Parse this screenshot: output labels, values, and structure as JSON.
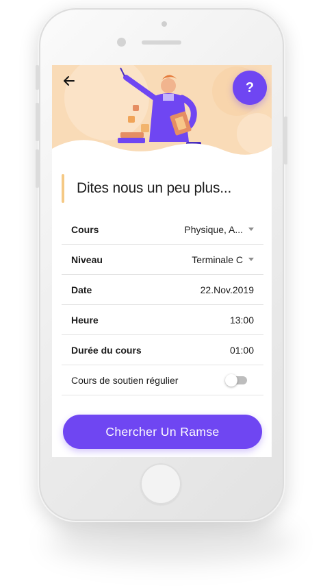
{
  "header": {
    "back_icon": "arrow-left-icon",
    "help_label": "?"
  },
  "section": {
    "title": "Dites nous un peu plus..."
  },
  "form": {
    "cours": {
      "label": "Cours",
      "value": "Physique, A..."
    },
    "niveau": {
      "label": "Niveau",
      "value": "Terminale C"
    },
    "date": {
      "label": "Date",
      "value": "22.Nov.2019"
    },
    "heure": {
      "label": "Heure",
      "value": "13:00"
    },
    "duree": {
      "label": "Durée du cours",
      "value": "01:00"
    },
    "soutien": {
      "label": "Cours de soutien régulier",
      "enabled": false
    }
  },
  "cta": {
    "label": "Chercher Un Ramse"
  },
  "colors": {
    "accent": "#6f46f2",
    "hero_background": "#f9d9b4",
    "title_bar": "#f5c985",
    "toggle_off": "#bdbdbd"
  }
}
